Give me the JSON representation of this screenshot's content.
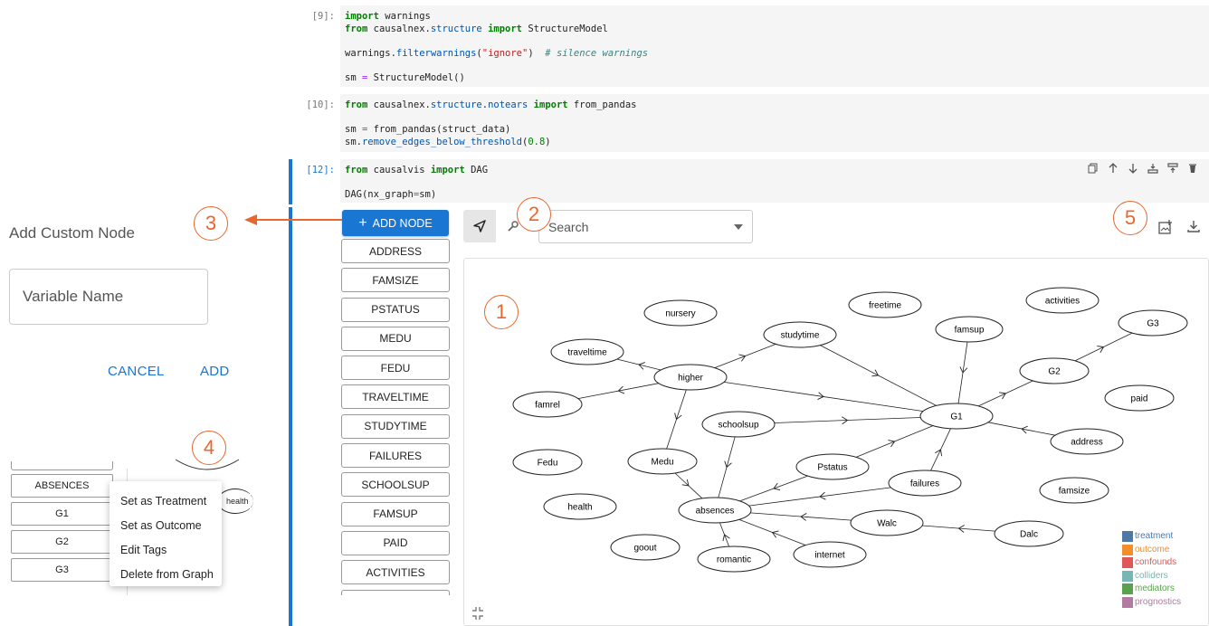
{
  "cells": [
    {
      "prompt": "[9]:",
      "lines": [
        [
          {
            "t": "import",
            "c": "kw"
          },
          {
            "t": " warnings",
            "c": ""
          }
        ],
        [
          {
            "t": "from",
            "c": "kw"
          },
          {
            "t": " causalnex.",
            "c": ""
          },
          {
            "t": "structure",
            "c": "mod"
          },
          {
            "t": " ",
            "c": ""
          },
          {
            "t": "import",
            "c": "kw"
          },
          {
            "t": " StructureModel",
            "c": ""
          }
        ],
        [],
        [
          {
            "t": "warnings.",
            "c": ""
          },
          {
            "t": "filterwarnings",
            "c": "mod"
          },
          {
            "t": "(",
            "c": ""
          },
          {
            "t": "\"ignore\"",
            "c": "str"
          },
          {
            "t": ")  ",
            "c": ""
          },
          {
            "t": "# silence warnings",
            "c": "cmt"
          }
        ],
        [],
        [
          {
            "t": "sm ",
            "c": ""
          },
          {
            "t": "=",
            "c": "op"
          },
          {
            "t": " StructureModel()",
            "c": ""
          }
        ]
      ]
    },
    {
      "prompt": "[10]:",
      "lines": [
        [
          {
            "t": "from",
            "c": "kw"
          },
          {
            "t": " causalnex.",
            "c": ""
          },
          {
            "t": "structure",
            "c": "mod"
          },
          {
            "t": ".",
            "c": ""
          },
          {
            "t": "notears",
            "c": "mod"
          },
          {
            "t": " ",
            "c": ""
          },
          {
            "t": "import",
            "c": "kw"
          },
          {
            "t": " from_pandas",
            "c": ""
          }
        ],
        [],
        [
          {
            "t": "sm ",
            "c": ""
          },
          {
            "t": "=",
            "c": "op"
          },
          {
            "t": " from_pandas(struct_data)",
            "c": ""
          }
        ],
        [
          {
            "t": "sm.",
            "c": ""
          },
          {
            "t": "remove_edges_below_threshold",
            "c": "mod"
          },
          {
            "t": "(",
            "c": ""
          },
          {
            "t": "0.8",
            "c": "num"
          },
          {
            "t": ")",
            "c": ""
          }
        ]
      ]
    },
    {
      "prompt": "[12]:",
      "lines": [
        [
          {
            "t": "from",
            "c": "kw"
          },
          {
            "t": " causalvis ",
            "c": ""
          },
          {
            "t": "import",
            "c": "kw"
          },
          {
            "t": " DAG",
            "c": ""
          }
        ],
        [],
        [
          {
            "t": "DAG(nx_graph",
            "c": ""
          },
          {
            "t": "=",
            "c": "op"
          },
          {
            "t": "sm)",
            "c": ""
          }
        ]
      ]
    }
  ],
  "cell_tools": [
    "copy-icon",
    "arrow-up-icon",
    "arrow-down-icon",
    "insert-below-icon",
    "insert-above-icon",
    "delete-icon"
  ],
  "add_node_label": "ADD NODE",
  "variables": [
    "ADDRESS",
    "FAMSIZE",
    "PSTATUS",
    "MEDU",
    "FEDU",
    "TRAVELTIME",
    "STUDYTIME",
    "FAILURES",
    "SCHOOLSUP",
    "FAMSUP",
    "PAID",
    "ACTIVITIES"
  ],
  "search_placeholder": "Search",
  "callouts": [
    "1",
    "2",
    "3",
    "4",
    "5"
  ],
  "graph": {
    "nodes": [
      {
        "id": "nursery",
        "label": "nursery"
      },
      {
        "id": "freetime",
        "label": "freetime"
      },
      {
        "id": "activities",
        "label": "activities"
      },
      {
        "id": "traveltime",
        "label": "traveltime"
      },
      {
        "id": "studytime",
        "label": "studytime"
      },
      {
        "id": "famsup",
        "label": "famsup"
      },
      {
        "id": "G3",
        "label": "G3"
      },
      {
        "id": "higher",
        "label": "higher"
      },
      {
        "id": "G2",
        "label": "G2"
      },
      {
        "id": "famrel",
        "label": "famrel"
      },
      {
        "id": "paid",
        "label": "paid"
      },
      {
        "id": "schoolsup",
        "label": "schoolsup"
      },
      {
        "id": "G1",
        "label": "G1"
      },
      {
        "id": "address",
        "label": "address"
      },
      {
        "id": "Fedu",
        "label": "Fedu"
      },
      {
        "id": "Medu",
        "label": "Medu"
      },
      {
        "id": "Pstatus",
        "label": "Pstatus"
      },
      {
        "id": "failures",
        "label": "failures"
      },
      {
        "id": "famsize",
        "label": "famsize"
      },
      {
        "id": "health",
        "label": "health"
      },
      {
        "id": "absences",
        "label": "absences"
      },
      {
        "id": "Walc",
        "label": "Walc"
      },
      {
        "id": "Dalc",
        "label": "Dalc"
      },
      {
        "id": "goout",
        "label": "goout"
      },
      {
        "id": "romantic",
        "label": "romantic"
      },
      {
        "id": "internet",
        "label": "internet"
      }
    ],
    "edges": [
      [
        "higher",
        "traveltime"
      ],
      [
        "higher",
        "famrel"
      ],
      [
        "higher",
        "studytime"
      ],
      [
        "higher",
        "G1"
      ],
      [
        "higher",
        "Medu"
      ],
      [
        "studytime",
        "G1"
      ],
      [
        "famsup",
        "G1"
      ],
      [
        "G1",
        "G2"
      ],
      [
        "G2",
        "G3"
      ],
      [
        "address",
        "G1"
      ],
      [
        "schoolsup",
        "G1"
      ],
      [
        "schoolsup",
        "absences"
      ],
      [
        "Pstatus",
        "G1"
      ],
      [
        "failures",
        "G1"
      ],
      [
        "Medu",
        "absences"
      ],
      [
        "Pstatus",
        "absences"
      ],
      [
        "failures",
        "absences"
      ],
      [
        "Walc",
        "absences"
      ],
      [
        "Dalc",
        "Walc"
      ],
      [
        "romantic",
        "absences"
      ],
      [
        "internet",
        "absences"
      ]
    ]
  },
  "legend": [
    {
      "label": "treatment",
      "color": "#4e79a7"
    },
    {
      "label": "outcome",
      "color": "#f28e2b"
    },
    {
      "label": "confounds",
      "color": "#e15759"
    },
    {
      "label": "colliders",
      "color": "#76b7b2"
    },
    {
      "label": "mediators",
      "color": "#59a14f"
    },
    {
      "label": "prognostics",
      "color": "#b07aa1"
    }
  ],
  "left_panel": {
    "title": "Add Custom Node",
    "input_placeholder": "Variable Name",
    "cancel": "CANCEL",
    "add": "ADD",
    "mini_vars": [
      "ABSENCES",
      "G1",
      "G2",
      "G3"
    ],
    "mini_node": "health",
    "menu": [
      "Set as Treatment",
      "Set as Outcome",
      "Edit Tags",
      "Delete from Graph"
    ]
  }
}
